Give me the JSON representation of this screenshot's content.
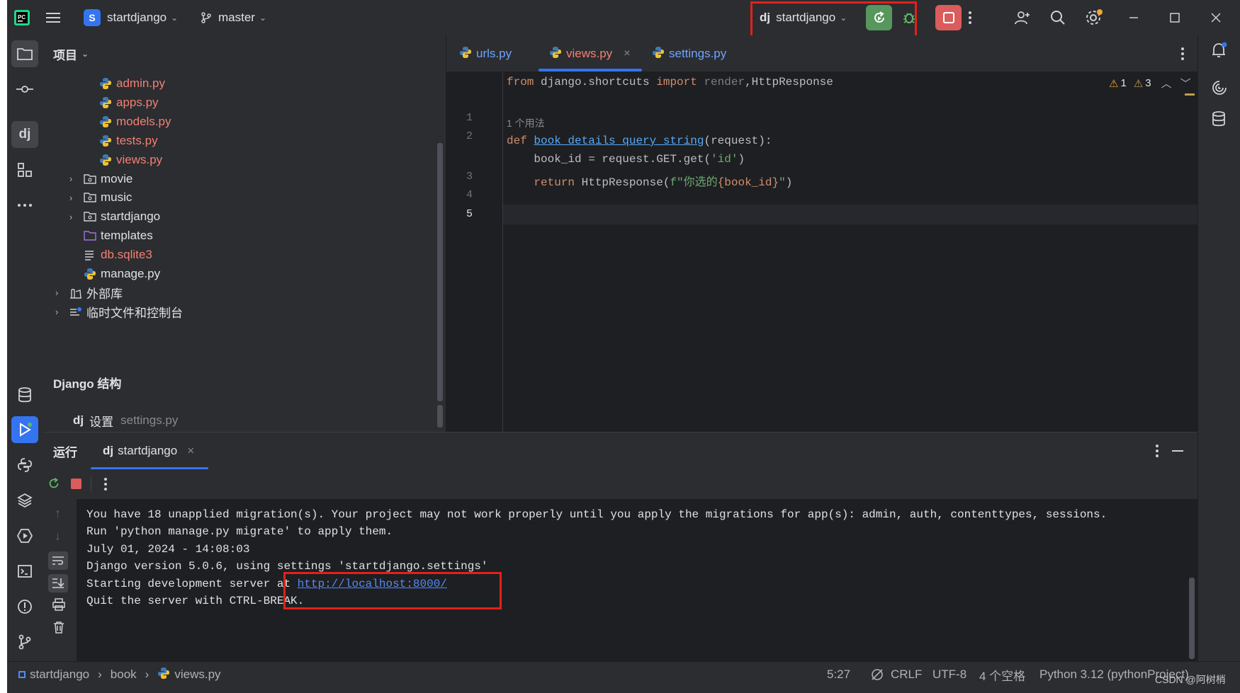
{
  "titlebar": {
    "project_badge": "S",
    "project_name": "startdjango",
    "branch": "master",
    "run_config": "startdjango",
    "run_config_icon": "dj"
  },
  "project_panel": {
    "title": "项目",
    "files": [
      {
        "name": "admin.py",
        "type": "python-file",
        "color": "red"
      },
      {
        "name": "apps.py",
        "type": "python-file",
        "color": "red"
      },
      {
        "name": "models.py",
        "type": "python-file",
        "color": "red"
      },
      {
        "name": "tests.py",
        "type": "python-file",
        "color": "red"
      },
      {
        "name": "views.py",
        "type": "python-file",
        "color": "red"
      },
      {
        "name": "movie",
        "type": "package",
        "color": "normal"
      },
      {
        "name": "music",
        "type": "package",
        "color": "normal"
      },
      {
        "name": "startdjango",
        "type": "package",
        "color": "normal"
      },
      {
        "name": "templates",
        "type": "folder",
        "color": "normal"
      },
      {
        "name": "db.sqlite3",
        "type": "text-file",
        "color": "red"
      },
      {
        "name": "manage.py",
        "type": "python-file",
        "color": "normal"
      },
      {
        "name": "外部库",
        "type": "library",
        "color": "normal"
      },
      {
        "name": "临时文件和控制台",
        "type": "scratches",
        "color": "normal"
      }
    ],
    "django_section_title": "Django 结构",
    "django_setting_label": "设置",
    "django_setting_value": "settings.py",
    "django_icon": "dj"
  },
  "editor": {
    "tabs": [
      {
        "label": "urls.py",
        "active": false
      },
      {
        "label": "views.py",
        "active": true
      },
      {
        "label": "settings.py",
        "active": false
      }
    ],
    "line_numbers": [
      "1",
      "2",
      "3",
      "4",
      "5"
    ],
    "usage_hint": "1 个用法",
    "code": {
      "line1_from": "from",
      "line1_module": " django.shortcuts ",
      "line1_import": "import",
      "line1_render": " render",
      "line1_rest": ",HttpResponse",
      "line3_def": "def",
      "line3_name": "book_details_query_string",
      "line3_args": "(request):",
      "line4": "    book_id = request.GET.get(",
      "line4_str": "'id'",
      "line4_end": ")",
      "line5_return": "return",
      "line5_call": " HttpResponse(",
      "line5_str1": "f\"你选的",
      "line5_expr": "{book_id}",
      "line5_str2": "\"",
      "line5_end": ")"
    },
    "inspections": {
      "warnings_a": "1",
      "warnings_b": "3"
    }
  },
  "run_panel": {
    "title": "运行",
    "tab_label": "startdjango",
    "tab_icon": "dj",
    "console": [
      "You have 18 unapplied migration(s). Your project may not work properly until you apply the migrations for app(s): admin, auth, contenttypes, sessions.",
      "Run 'python manage.py migrate' to apply them.",
      "July 01, 2024 - 14:08:03",
      "Django version 5.0.6, using settings 'startdjango.settings'",
      "Quit the server with CTRL-BREAK."
    ],
    "server_line_prefix": "Starting development server at ",
    "server_url": "http://localhost:8000/"
  },
  "statusbar": {
    "breadcrumb": [
      "startdjango",
      "book",
      "views.py"
    ],
    "position": "5:27",
    "line_ending": "CRLF",
    "encoding": "UTF-8",
    "indent": "4 个空格",
    "interpreter": "Python 3.12 (pythonProject)"
  },
  "watermark": "CSDN @阿树梢",
  "colors": {
    "accent": "#3574f0",
    "run_green": "#57965c",
    "stop_red": "#db5c5c",
    "highlight_box": "#e2211c",
    "modified_file": "#f57f73"
  }
}
